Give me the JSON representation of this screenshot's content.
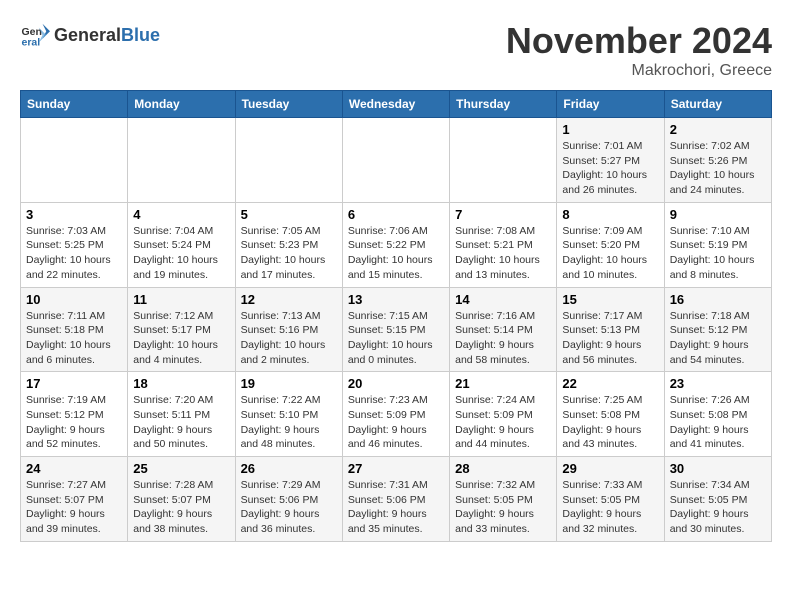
{
  "logo": {
    "general": "General",
    "blue": "Blue"
  },
  "header": {
    "month": "November 2024",
    "location": "Makrochori, Greece"
  },
  "weekdays": [
    "Sunday",
    "Monday",
    "Tuesday",
    "Wednesday",
    "Thursday",
    "Friday",
    "Saturday"
  ],
  "weeks": [
    [
      {
        "day": "",
        "info": ""
      },
      {
        "day": "",
        "info": ""
      },
      {
        "day": "",
        "info": ""
      },
      {
        "day": "",
        "info": ""
      },
      {
        "day": "",
        "info": ""
      },
      {
        "day": "1",
        "info": "Sunrise: 7:01 AM\nSunset: 5:27 PM\nDaylight: 10 hours\nand 26 minutes."
      },
      {
        "day": "2",
        "info": "Sunrise: 7:02 AM\nSunset: 5:26 PM\nDaylight: 10 hours\nand 24 minutes."
      }
    ],
    [
      {
        "day": "3",
        "info": "Sunrise: 7:03 AM\nSunset: 5:25 PM\nDaylight: 10 hours\nand 22 minutes."
      },
      {
        "day": "4",
        "info": "Sunrise: 7:04 AM\nSunset: 5:24 PM\nDaylight: 10 hours\nand 19 minutes."
      },
      {
        "day": "5",
        "info": "Sunrise: 7:05 AM\nSunset: 5:23 PM\nDaylight: 10 hours\nand 17 minutes."
      },
      {
        "day": "6",
        "info": "Sunrise: 7:06 AM\nSunset: 5:22 PM\nDaylight: 10 hours\nand 15 minutes."
      },
      {
        "day": "7",
        "info": "Sunrise: 7:08 AM\nSunset: 5:21 PM\nDaylight: 10 hours\nand 13 minutes."
      },
      {
        "day": "8",
        "info": "Sunrise: 7:09 AM\nSunset: 5:20 PM\nDaylight: 10 hours\nand 10 minutes."
      },
      {
        "day": "9",
        "info": "Sunrise: 7:10 AM\nSunset: 5:19 PM\nDaylight: 10 hours\nand 8 minutes."
      }
    ],
    [
      {
        "day": "10",
        "info": "Sunrise: 7:11 AM\nSunset: 5:18 PM\nDaylight: 10 hours\nand 6 minutes."
      },
      {
        "day": "11",
        "info": "Sunrise: 7:12 AM\nSunset: 5:17 PM\nDaylight: 10 hours\nand 4 minutes."
      },
      {
        "day": "12",
        "info": "Sunrise: 7:13 AM\nSunset: 5:16 PM\nDaylight: 10 hours\nand 2 minutes."
      },
      {
        "day": "13",
        "info": "Sunrise: 7:15 AM\nSunset: 5:15 PM\nDaylight: 10 hours\nand 0 minutes."
      },
      {
        "day": "14",
        "info": "Sunrise: 7:16 AM\nSunset: 5:14 PM\nDaylight: 9 hours\nand 58 minutes."
      },
      {
        "day": "15",
        "info": "Sunrise: 7:17 AM\nSunset: 5:13 PM\nDaylight: 9 hours\nand 56 minutes."
      },
      {
        "day": "16",
        "info": "Sunrise: 7:18 AM\nSunset: 5:12 PM\nDaylight: 9 hours\nand 54 minutes."
      }
    ],
    [
      {
        "day": "17",
        "info": "Sunrise: 7:19 AM\nSunset: 5:12 PM\nDaylight: 9 hours\nand 52 minutes."
      },
      {
        "day": "18",
        "info": "Sunrise: 7:20 AM\nSunset: 5:11 PM\nDaylight: 9 hours\nand 50 minutes."
      },
      {
        "day": "19",
        "info": "Sunrise: 7:22 AM\nSunset: 5:10 PM\nDaylight: 9 hours\nand 48 minutes."
      },
      {
        "day": "20",
        "info": "Sunrise: 7:23 AM\nSunset: 5:09 PM\nDaylight: 9 hours\nand 46 minutes."
      },
      {
        "day": "21",
        "info": "Sunrise: 7:24 AM\nSunset: 5:09 PM\nDaylight: 9 hours\nand 44 minutes."
      },
      {
        "day": "22",
        "info": "Sunrise: 7:25 AM\nSunset: 5:08 PM\nDaylight: 9 hours\nand 43 minutes."
      },
      {
        "day": "23",
        "info": "Sunrise: 7:26 AM\nSunset: 5:08 PM\nDaylight: 9 hours\nand 41 minutes."
      }
    ],
    [
      {
        "day": "24",
        "info": "Sunrise: 7:27 AM\nSunset: 5:07 PM\nDaylight: 9 hours\nand 39 minutes."
      },
      {
        "day": "25",
        "info": "Sunrise: 7:28 AM\nSunset: 5:07 PM\nDaylight: 9 hours\nand 38 minutes."
      },
      {
        "day": "26",
        "info": "Sunrise: 7:29 AM\nSunset: 5:06 PM\nDaylight: 9 hours\nand 36 minutes."
      },
      {
        "day": "27",
        "info": "Sunrise: 7:31 AM\nSunset: 5:06 PM\nDaylight: 9 hours\nand 35 minutes."
      },
      {
        "day": "28",
        "info": "Sunrise: 7:32 AM\nSunset: 5:05 PM\nDaylight: 9 hours\nand 33 minutes."
      },
      {
        "day": "29",
        "info": "Sunrise: 7:33 AM\nSunset: 5:05 PM\nDaylight: 9 hours\nand 32 minutes."
      },
      {
        "day": "30",
        "info": "Sunrise: 7:34 AM\nSunset: 5:05 PM\nDaylight: 9 hours\nand 30 minutes."
      }
    ]
  ]
}
